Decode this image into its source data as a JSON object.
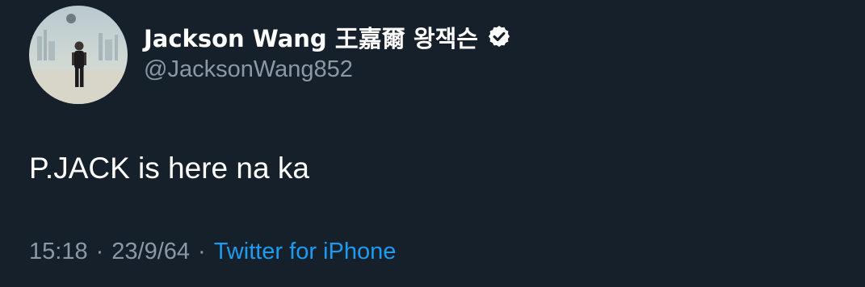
{
  "tweet": {
    "author": {
      "display_name": "Jackson Wang 王嘉爾 왕잭슨",
      "handle": "@JacksonWang852",
      "verified": true,
      "avatar_icon": "profile-photo"
    },
    "text": "P.JACK is here na ka",
    "meta": {
      "time": "15:18",
      "separator": "·",
      "date": "23/9/64",
      "source": "Twitter for iPhone"
    }
  },
  "colors": {
    "background": "#15202b",
    "primary_text": "#ffffff",
    "secondary_text": "#8b98a5",
    "accent": "#1d9bf0"
  }
}
